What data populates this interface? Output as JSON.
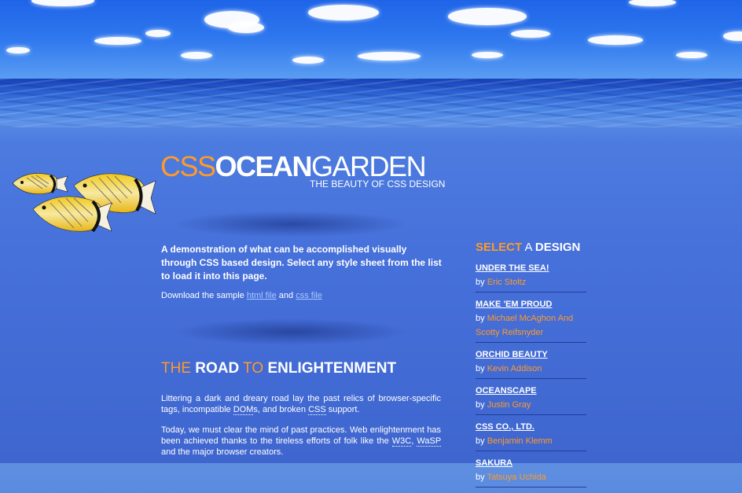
{
  "logo": {
    "part1": "CSS",
    "part2": "OCEAN",
    "part3": "GARDEN",
    "tagline": "THE BEAUTY OF CSS DESIGN"
  },
  "intro": {
    "text": "A demonstration of what can be accomplished visually through CSS based design.  Select any style sheet from the list to load it into this page.",
    "download_prefix": "Download the sample ",
    "html_link": "html file",
    "and": " and ",
    "css_link": "css file"
  },
  "road": {
    "w1": "THE",
    "w2": "ROAD",
    "w3": "TO",
    "w4": "ENLIGHTENMENT",
    "p1_a": "Littering a dark and dreary road lay the past relics of browser-specific tags, incompatible ",
    "p1_dom": "DOM",
    "p1_b": "s, and broken ",
    "p1_css": "CSS",
    "p1_c": " support.",
    "p2_a": "Today, we must clear the mind of past practices. Web enlightenment has been achieved thanks to the tireless efforts of folk like the ",
    "p2_w3c": "W3C",
    "p2_b": ", ",
    "p2_wasp": "WaSP",
    "p2_c": " and the major browser creators."
  },
  "sidebar": {
    "title_select": "SELECT",
    "title_a": " A ",
    "title_design": "DESIGN",
    "by": "by ",
    "designs": [
      {
        "name": "UNDER THE SEA!",
        "author": "Eric Stoltz"
      },
      {
        "name": "MAKE 'EM PROUD",
        "author": "Michael McAghon And Scotty Reifsnyder"
      },
      {
        "name": "ORCHID BEAUTY",
        "author": "Kevin Addison"
      },
      {
        "name": "OCEANSCAPE",
        "author": "Justin Gray"
      },
      {
        "name": "CSS CO., LTD.",
        "author": "Benjamin Klemm"
      },
      {
        "name": "SAKURA",
        "author": "Tatsuya Uchida"
      }
    ]
  },
  "colors": {
    "accent": "#ff9a2a",
    "background": "#4670da",
    "divider": "#1f3f99"
  }
}
